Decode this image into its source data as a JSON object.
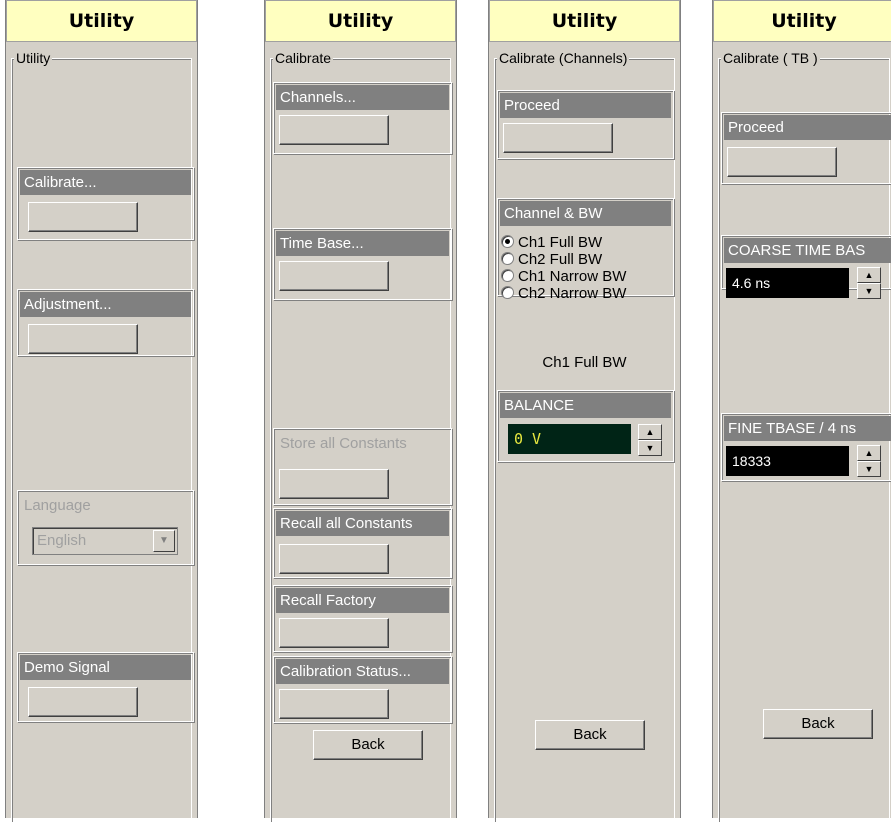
{
  "panel1": {
    "header": "Utility",
    "group_title": "Utility",
    "calibrate_label": "Calibrate...",
    "adjustment_label": "Adjustment...",
    "language_label": "Language",
    "language_value": "English",
    "demo_label": "Demo Signal"
  },
  "panel2": {
    "header": "Utility",
    "group_title": "Calibrate",
    "channels_label": "Channels...",
    "timebase_label": "Time Base...",
    "store_label": "Store all Constants",
    "recall_all_label": "Recall all Constants",
    "recall_factory_label": "Recall Factory",
    "cal_status_label": "Calibration Status...",
    "back_label": "Back"
  },
  "panel3": {
    "header": "Utility",
    "group_title": "Calibrate (Channels)",
    "proceed_label": "Proceed",
    "channel_bw_label": "Channel & BW",
    "radio_options": [
      "Ch1 Full BW",
      "Ch2 Full BW",
      "Ch1 Narrow BW",
      "Ch2 Narrow BW"
    ],
    "selected_index": 0,
    "selected_text": "Ch1 Full BW",
    "balance_label": "BALANCE",
    "balance_value": "0 V",
    "back_label": "Back"
  },
  "panel4": {
    "header": "Utility",
    "group_title": "Calibrate ( TB )",
    "proceed_label": "Proceed",
    "coarse_label": "COARSE TIME BAS",
    "coarse_value": "4.6 ns",
    "fine_label": "FINE TBASE / 4 ns",
    "fine_value": "18333",
    "back_label": "Back"
  },
  "icons": {
    "spin_up": "▲",
    "spin_down": "▼",
    "dropdown": "▼"
  }
}
